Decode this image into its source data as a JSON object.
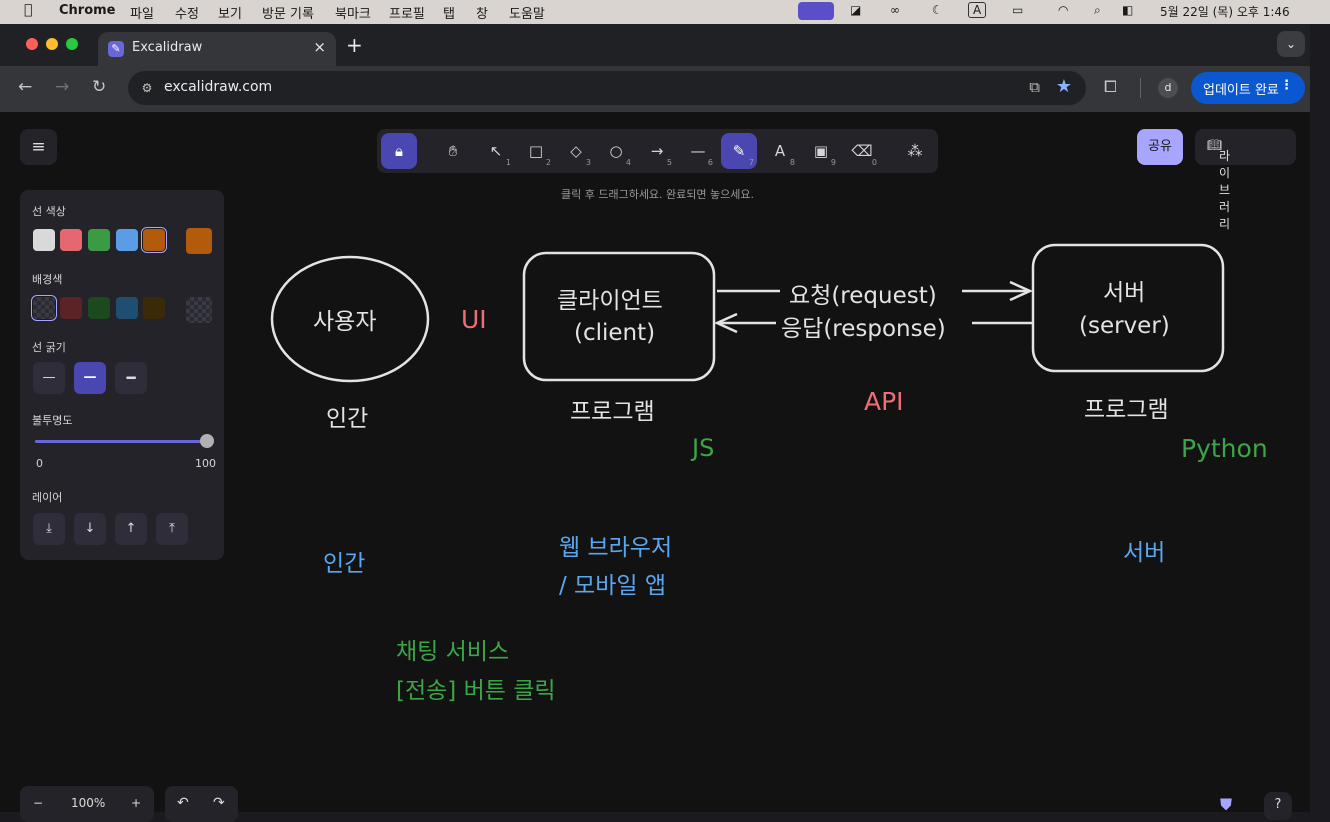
{
  "menubar": {
    "apple": "",
    "items": [
      "Chrome",
      "파일",
      "수정",
      "보기",
      "방문 기록",
      "북마크",
      "프로필",
      "탭",
      "창",
      "도움말"
    ],
    "datetime": "5월 22일 (목) 오후 1:46"
  },
  "browser": {
    "tab_title": "Excalidraw",
    "tab_close": "×",
    "new_tab": "+",
    "url": "excalidraw.com",
    "profile_initial": "d",
    "update_label": "업데이트 완료",
    "update_more": "⋮"
  },
  "excalidraw": {
    "menu_icon": "hamburger-icon",
    "tools": [
      {
        "name": "lock",
        "glyph": "🔒︎",
        "key": ""
      },
      {
        "name": "hand",
        "glyph": "✋︎",
        "key": ""
      },
      {
        "name": "selection",
        "glyph": "↖",
        "key": "1"
      },
      {
        "name": "rectangle",
        "glyph": "□",
        "key": "2"
      },
      {
        "name": "diamond",
        "glyph": "◇",
        "key": "3"
      },
      {
        "name": "ellipse",
        "glyph": "○",
        "key": "4"
      },
      {
        "name": "arrow",
        "glyph": "→",
        "key": "5"
      },
      {
        "name": "line",
        "glyph": "—",
        "key": "6"
      },
      {
        "name": "draw",
        "glyph": "✎",
        "key": "7"
      },
      {
        "name": "text",
        "glyph": "A",
        "key": "8"
      },
      {
        "name": "image",
        "glyph": "▣",
        "key": "9"
      },
      {
        "name": "eraser",
        "glyph": "⌫",
        "key": "0"
      },
      {
        "name": "more-tools",
        "glyph": "⁂",
        "key": ""
      }
    ],
    "hint": "클릭 후 드래그하세요. 완료되면 놓으세요.",
    "share_label": "공유",
    "library_label": "라이브러리",
    "panel": {
      "stroke_color_label": "선 색상",
      "stroke_colors": [
        "#d9d9d9",
        "#e56870",
        "#3a9b44",
        "#5b9ce6",
        "#b35b0d"
      ],
      "stroke_current": "#b35b0d",
      "background_label": "배경색",
      "background_colors": [
        "transparent",
        "#5c2327",
        "#1a4a1e",
        "#1e4f72",
        "#3a2a08"
      ],
      "stroke_width_label": "선 굵기",
      "opacity_label": "불투명도",
      "opacity_value": 100,
      "opacity_min": "0",
      "opacity_max": "100",
      "layers_label": "레이어"
    },
    "zoom_level": "100%",
    "zoom_minus": "−",
    "zoom_plus": "+",
    "help": "?"
  },
  "canvas": {
    "colors": {
      "white": "#e3e3e3",
      "red": "#ee6e76",
      "green": "#3ca646",
      "blue": "#5ba7ef"
    },
    "user_node": "사용자",
    "ui_label": "UI",
    "client_line1": "클라이언트",
    "client_line2": "(client)",
    "request_label": "요청(request)",
    "response_label": "응답(response)",
    "server_line1": "서버",
    "server_line2": "(server)",
    "human_label": "인간",
    "program_label_client": "프로그램",
    "api_label": "API",
    "program_label_server": "프로그램",
    "js_label": "JS",
    "python_label": "Python",
    "human_blue": "인간",
    "web_browser_line1": "웹 브라우저",
    "web_browser_line2": "/ 모바일 앱",
    "server_blue": "서버",
    "chat_line1": "채팅 서비스",
    "chat_line2": "[전송] 버튼 클릭"
  }
}
